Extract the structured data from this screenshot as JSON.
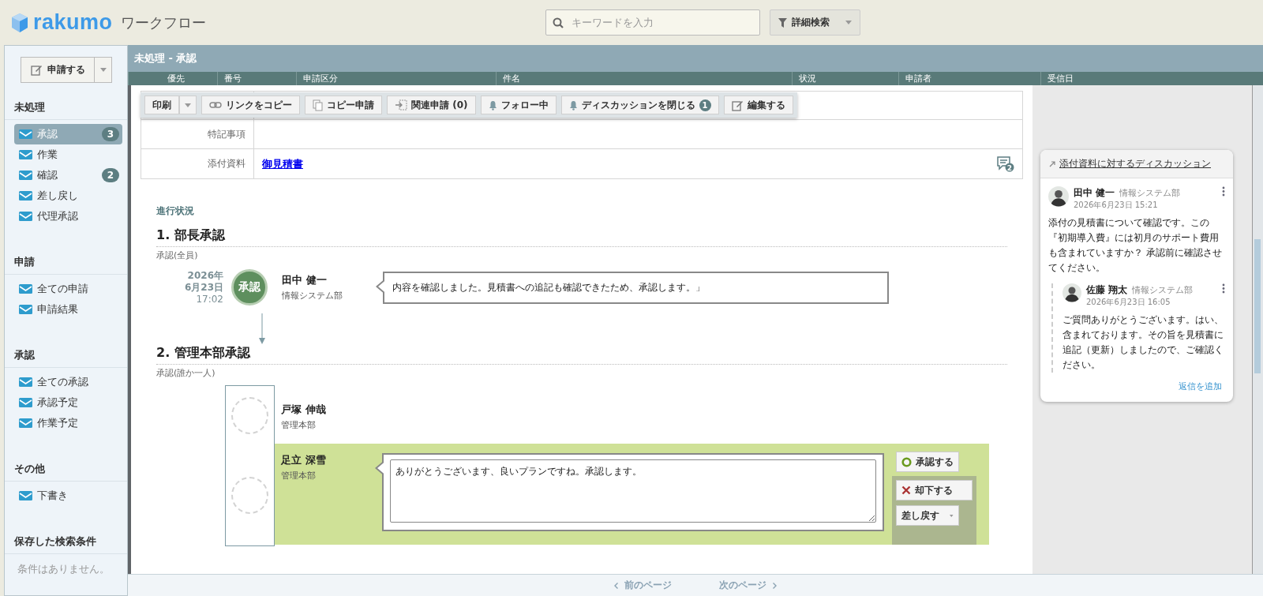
{
  "header": {
    "logo": "rakumo",
    "app_title": "ワークフロー",
    "search": {
      "placeholder": "キーワードを入力"
    },
    "advanced_search": "詳細検索"
  },
  "sidebar": {
    "new_button": "申請する",
    "sections": [
      {
        "title": "未処理",
        "items": [
          {
            "label": "承認",
            "badge": "3",
            "selected": true
          },
          {
            "label": "作業",
            "selected": false
          },
          {
            "label": "確認",
            "badge": "2",
            "selected": false
          },
          {
            "label": "差し戻し",
            "selected": false
          },
          {
            "label": "代理承認",
            "selected": false
          }
        ]
      },
      {
        "title": "申請",
        "items": [
          {
            "label": "全ての申請",
            "selected": false
          },
          {
            "label": "申請結果",
            "selected": false
          }
        ]
      },
      {
        "title": "承認",
        "items": [
          {
            "label": "全ての承認",
            "selected": false
          },
          {
            "label": "承認予定",
            "selected": false
          },
          {
            "label": "作業予定",
            "selected": false
          }
        ]
      },
      {
        "title": "その他",
        "items": [
          {
            "label": "下書き",
            "selected": false
          }
        ]
      }
    ],
    "saved": {
      "title": "保存した検索条件",
      "empty": "条件はありません。"
    }
  },
  "list": {
    "title": "未処理 - 承認",
    "columns": [
      "優先",
      "番号",
      "申請区分",
      "件名",
      "状況",
      "申請者",
      "受信日"
    ]
  },
  "toolbar": [
    {
      "kind": "split",
      "label": "印刷"
    },
    {
      "kind": "link",
      "label": "リンクをコピー"
    },
    {
      "kind": "copy",
      "label": "コピー申請"
    },
    {
      "kind": "related",
      "label": "関連申請 (0)"
    },
    {
      "kind": "bell",
      "label": "フォロー中"
    },
    {
      "kind": "bell",
      "label": "ディスカッションを閉じる",
      "badge": "1"
    },
    {
      "kind": "edit",
      "label": "編集する"
    }
  ],
  "details": [
    {
      "label": "特記事項"
    },
    {
      "label": "添付資料",
      "link": "御見積書",
      "comment_count": "2"
    }
  ],
  "progress": {
    "title": "進行状況",
    "steps": [
      {
        "title": "1. 部長承認",
        "rule": "承認(全員)",
        "approvers": [
          {
            "kind": "approved",
            "year": "2026年",
            "date": "6月23日",
            "time": "17:02",
            "stamp": "承認",
            "name": "田中 健一",
            "dept": "情報システム部",
            "comment": "内容を確認しました。見積書への追記も確認できたため、承認します。」"
          }
        ]
      },
      {
        "title": "2. 管理本部承認",
        "rule": "承認(誰か一人)",
        "approvers": [
          {
            "kind": "pending",
            "name": "戸塚 伸哉",
            "dept": "管理本部",
            "current": false
          },
          {
            "kind": "pending",
            "name": "足立 深雪",
            "dept": "管理本部",
            "current": true,
            "comment": "ありがとうございます、良いプランですね。承認します。"
          }
        ]
      }
    ],
    "actions": [
      {
        "kind": "approve",
        "label": "承認する"
      },
      {
        "kind": "reject",
        "label": "却下する"
      },
      {
        "kind": "return",
        "label": "差し戻す"
      }
    ]
  },
  "discussion": {
    "title": "添付資料に対するディスカッション",
    "comments": [
      {
        "name": "田中 健一",
        "dept": "情報システム部",
        "time": "2026年6月23日 15:21",
        "text": "添付の見積書について確認です。この『初期導入費』には初月のサポート費用も含まれていますか？ 承認前に確認させてください。",
        "replies": [
          {
            "name": "佐藤 翔太",
            "dept": "情報システム部",
            "time": "2026年6月23日 16:05",
            "text": "ご質問ありがとうございます。はい、含まれております。その旨を見積書に追記（更新）しましたので、ご確認ください。"
          }
        ]
      }
    ],
    "reply_link": "返信を追加"
  },
  "pager": {
    "prev": "前のページ",
    "next": "次のページ",
    "disabled": true
  }
}
